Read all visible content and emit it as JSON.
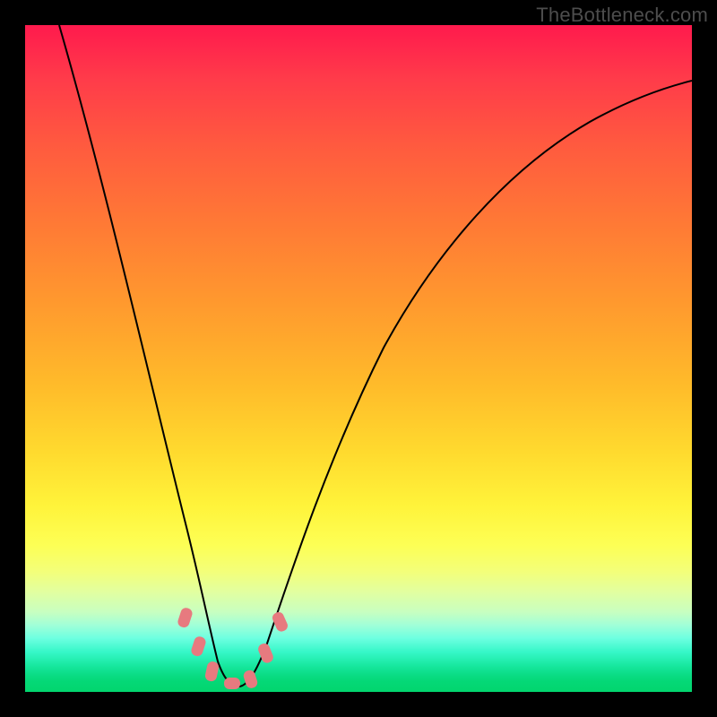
{
  "watermark": "TheBottleneck.com",
  "colors": {
    "background": "#000000",
    "curve_stroke": "#000000",
    "marker_fill": "#e77a7f",
    "gradient_top": "#ff1a4d",
    "gradient_bottom": "#02d56e"
  },
  "chart_data": {
    "type": "line",
    "title": "",
    "xlabel": "",
    "ylabel": "",
    "xlim": [
      0,
      100
    ],
    "ylim": [
      0,
      100
    ],
    "x": [
      5,
      10,
      15,
      20,
      22.5,
      25,
      27,
      28.5,
      30,
      31.5,
      33,
      35,
      40,
      45,
      50,
      55,
      60,
      65,
      70,
      75,
      80,
      85,
      90,
      95,
      100
    ],
    "values": [
      100,
      75,
      50,
      25,
      15,
      7,
      3,
      1,
      1,
      1,
      3,
      8,
      25,
      40,
      52,
      60,
      66,
      72,
      76,
      79,
      82,
      84.5,
      86.5,
      88,
      89
    ],
    "marker_points": [
      {
        "x": 23.5,
        "y": 11
      },
      {
        "x": 25.5,
        "y": 6
      },
      {
        "x": 27.5,
        "y": 2
      },
      {
        "x": 30.0,
        "y": 1
      },
      {
        "x": 32.5,
        "y": 2.5
      },
      {
        "x": 34.5,
        "y": 7
      },
      {
        "x": 36.0,
        "y": 12
      }
    ],
    "notes": "V-shaped curve on a vertical rainbow gradient; y-axis appears inverted visually (0 at top, 100 at bottom in data domain). Minimum of curve around x≈30."
  }
}
